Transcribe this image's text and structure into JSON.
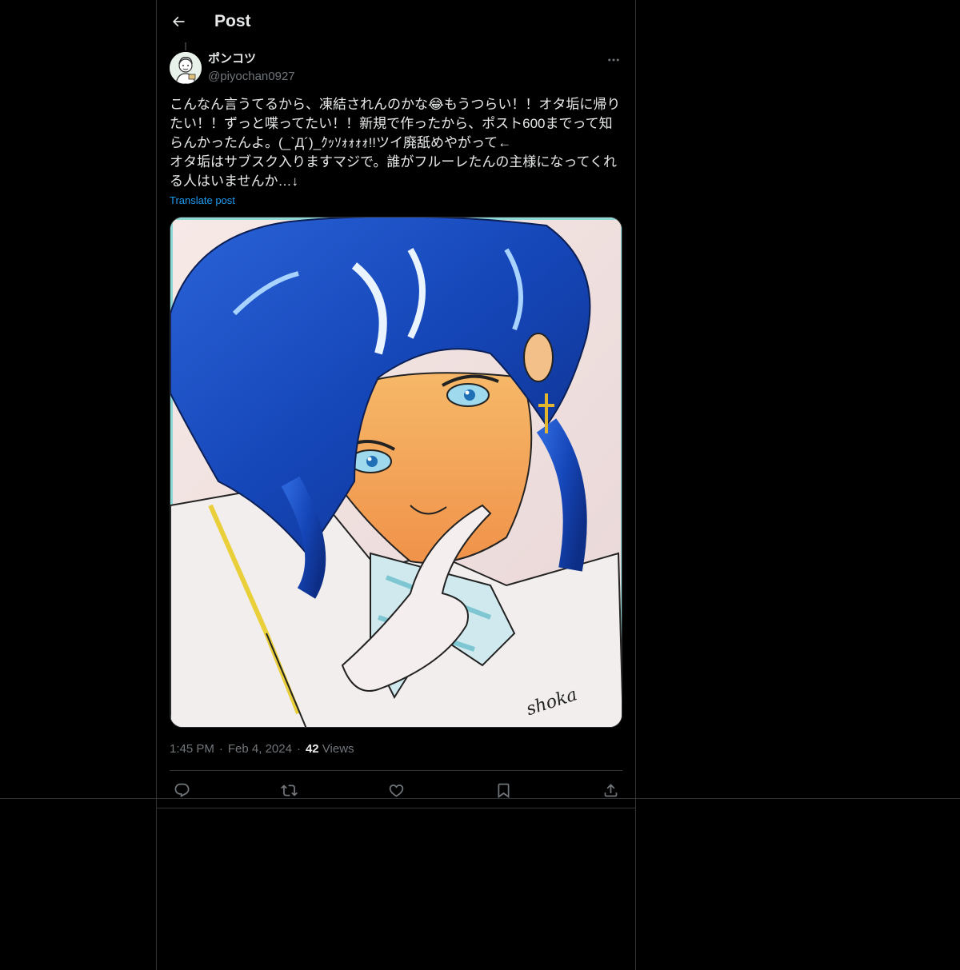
{
  "header": {
    "title": "Post"
  },
  "post": {
    "author_name": "ポンコツ",
    "author_handle": "@piyochan0927",
    "text": "こんなん言うてるから、凍結されんのかな😂もうつらい！！オタ垢に帰りたい！！ずっと喋ってたい！！新規で作ったから、ポスト600までって知らんかったんよ。(_`Д´)_ｸｯｿｫｫｫｫ!!ツイ廃舐めやがって←\nオタ垢はサブスク入りますマジで。誰がフルーレたんの主様になってくれる人はいませんか…↓",
    "translate_label": "Translate post",
    "time": "1:45 PM",
    "date": "Feb 4, 2024",
    "views_count": "42",
    "views_label": "Views",
    "media_signature": "shoka"
  },
  "icons": {
    "back": "arrow-left-icon",
    "more": "more-icon",
    "reply": "reply-icon",
    "repost": "repost-icon",
    "like": "heart-icon",
    "bookmark": "bookmark-icon",
    "share": "share-icon"
  },
  "colors": {
    "background": "#000000",
    "text": "#e7e9ea",
    "secondary_text": "#71767b",
    "link": "#1d9bf0",
    "border": "#2f3336"
  }
}
